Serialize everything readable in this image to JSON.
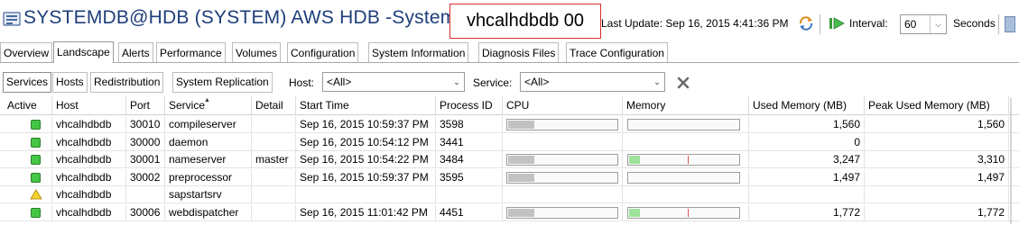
{
  "window": {
    "title": "SYSTEMDB@HDB (SYSTEM) AWS HDB -SystemDB",
    "sid_badge": "vhcalhdbdb 00",
    "last_update_label": "Last Update:",
    "last_update_value": "Sep 16, 2015 4:41:36 PM",
    "interval_label": "Interval:",
    "interval_value": "60",
    "seconds_label": "Seconds"
  },
  "main_tabs": [
    {
      "label": "Overview"
    },
    {
      "label": "Landscape",
      "active": true
    },
    {
      "label": "Alerts"
    },
    {
      "label": "Performance"
    },
    {
      "label": "Volumes"
    },
    {
      "label": "Configuration"
    },
    {
      "label": "System Information"
    },
    {
      "label": "Diagnosis Files"
    },
    {
      "label": "Trace Configuration"
    }
  ],
  "sub_tabs": [
    {
      "label": "Services",
      "active": true
    },
    {
      "label": "Hosts"
    },
    {
      "label": "Redistribution"
    },
    {
      "label": "System Replication"
    }
  ],
  "filters": {
    "host_label": "Host:",
    "host_value": "<All>",
    "service_label": "Service:",
    "service_value": "<All>"
  },
  "table": {
    "columns": [
      "Active",
      "Host",
      "Port",
      "Service",
      "Detail",
      "Start Time",
      "Process ID",
      "CPU",
      "Memory",
      "Used Memory (MB)",
      "Peak Used Memory (MB)"
    ],
    "rows": [
      {
        "status": "green",
        "host": "vhcalhdbdb",
        "port": "30010",
        "service": "compileserver",
        "detail": "",
        "start_time": "Sep 16, 2015 10:59:37 PM",
        "pid": "3598",
        "cpu_level": 0.24,
        "mem_level": 0.0,
        "mem_peak": null,
        "used": "1,560",
        "peak": "1,560"
      },
      {
        "status": "green",
        "host": "vhcalhdbdb",
        "port": "30000",
        "service": "daemon",
        "detail": "",
        "start_time": "Sep 16, 2015 10:54:12 PM",
        "pid": "3441",
        "cpu_level": null,
        "mem_level": null,
        "mem_peak": null,
        "used": "0",
        "peak": ""
      },
      {
        "status": "green",
        "host": "vhcalhdbdb",
        "port": "30001",
        "service": "nameserver",
        "detail": "master",
        "start_time": "Sep 16, 2015 10:54:22 PM",
        "pid": "3484",
        "cpu_level": 0.24,
        "mem_level": 0.1,
        "mem_peak": 0.54,
        "used": "3,247",
        "peak": "3,310"
      },
      {
        "status": "green",
        "host": "vhcalhdbdb",
        "port": "30002",
        "service": "preprocessor",
        "detail": "",
        "start_time": "Sep 16, 2015 10:59:37 PM",
        "pid": "3595",
        "cpu_level": 0.24,
        "mem_level": 0.0,
        "mem_peak": null,
        "used": "1,497",
        "peak": "1,497"
      },
      {
        "status": "warning",
        "host": "vhcalhdbdb",
        "port": "",
        "service": "sapstartsrv",
        "detail": "",
        "start_time": "",
        "pid": "",
        "cpu_level": null,
        "mem_level": null,
        "mem_peak": null,
        "used": "",
        "peak": ""
      },
      {
        "status": "green",
        "host": "vhcalhdbdb",
        "port": "30006",
        "service": "webdispatcher",
        "detail": "",
        "start_time": "Sep 16, 2015 11:01:42 PM",
        "pid": "4451",
        "cpu_level": 0.24,
        "mem_level": 0.1,
        "mem_peak": 0.54,
        "used": "1,772",
        "peak": "1,772"
      }
    ]
  },
  "colors": {
    "title": "#1f3e7a",
    "badge_border": "#d9302a",
    "status_green": "#44c744",
    "status_warning": "#f5d327",
    "memory_fill": "#9fe29b",
    "memory_peak": "#d9534f"
  },
  "icons": {
    "title_icon": "database-system-icon",
    "refresh": "refresh-icon",
    "interval_play": "play-icon",
    "clear_filter": "close-x-icon",
    "sort": "sort-ascending-icon",
    "status_green": "status-running-icon",
    "status_warning": "warning-triangle-icon"
  }
}
